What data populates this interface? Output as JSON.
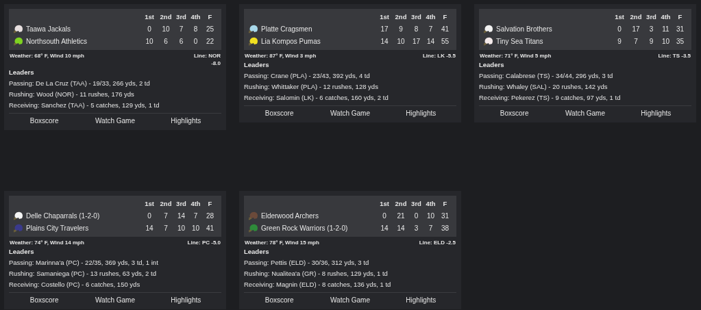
{
  "games": [
    {
      "periods": [
        "1st",
        "2nd",
        "3rd",
        "4th",
        "F"
      ],
      "teams": [
        {
          "name": "Taawa Jackals",
          "color": "#e8e0e0",
          "scores": [
            "0",
            "10",
            "7",
            "8",
            "25"
          ]
        },
        {
          "name": "Northsouth Athletics",
          "color": "#7ed321",
          "scores": [
            "10",
            "6",
            "6",
            "0",
            "22"
          ]
        }
      ],
      "weather": "Weather: 68° F, Wind 10 mph",
      "line": "Line: NOR -8.0",
      "leaders_title": "Leaders",
      "leaders": [
        "Passing: De La Cruz (TAA) - 19/33, 266 yds, 2 td",
        "Rushing: Wood (NOR) - 11 rushes, 176 yds",
        "Receiving: Sanchez (TAA) - 5 catches, 129 yds, 1 td"
      ],
      "links": [
        "Boxscore",
        "Watch Game",
        "Highlights"
      ]
    },
    {
      "periods": [
        "1st",
        "2nd",
        "3rd",
        "4th",
        "F"
      ],
      "teams": [
        {
          "name": "Platte Cragsmen",
          "color": "#a8d8ea",
          "scores": [
            "17",
            "9",
            "8",
            "7",
            "41"
          ]
        },
        {
          "name": "Lia Kompos Pumas",
          "color": "#f0e020",
          "scores": [
            "14",
            "10",
            "17",
            "14",
            "55"
          ]
        }
      ],
      "weather": "Weather: 87° F, Wind 3 mph",
      "line": "Line: LK -5.5",
      "leaders_title": "Leaders",
      "leaders": [
        "Passing: Crane (PLA) - 23/43, 392 yds, 4 td",
        "Rushing: Whittaker (PLA) - 12 rushes, 128 yds",
        "Receiving: Salomin (LK) - 6 catches, 160 yds, 2 td"
      ],
      "links": [
        "Boxscore",
        "Watch Game",
        "Highlights"
      ]
    },
    {
      "periods": [
        "1st",
        "2nd",
        "3rd",
        "4th",
        "F"
      ],
      "teams": [
        {
          "name": "Salvation Brothers",
          "color": "#f2f2f2",
          "scores": [
            "0",
            "17",
            "3",
            "11",
            "31"
          ]
        },
        {
          "name": "Tiny Sea Titans",
          "color": "#f4eaea",
          "scores": [
            "9",
            "7",
            "9",
            "10",
            "35"
          ]
        }
      ],
      "weather": "Weather: 71° F, Wind 5 mph",
      "line": "Line: TS -3.5",
      "leaders_title": "Leaders",
      "leaders": [
        "Passing: Calabrese (TS) - 34/44, 296 yds, 3 td",
        "Rushing: Whaley (SAL) - 20 rushes, 142 yds",
        "Receiving: Pekerez (TS) - 9 catches, 97 yds, 1 td"
      ],
      "links": [
        "Boxscore",
        "Watch Game",
        "Highlights"
      ]
    },
    {
      "periods": [
        "1st",
        "2nd",
        "3rd",
        "4th",
        "F"
      ],
      "teams": [
        {
          "name": "Delle Chaparrals (1-2-0)",
          "color": "#f4f4f4",
          "scores": [
            "0",
            "7",
            "14",
            "7",
            "28"
          ]
        },
        {
          "name": "Plains City Travelers",
          "color": "#3a3a8c",
          "scores": [
            "14",
            "7",
            "10",
            "10",
            "41"
          ]
        }
      ],
      "weather": "Weather: 74° F, Wind 14 mph",
      "line": "Line: PC -5.0",
      "leaders_title": "Leaders",
      "leaders": [
        "Passing: Marinna'a (PC) - 22/35, 369 yds, 3 td, 1 int",
        "Rushing: Samaniega (PC) - 13 rushes, 63 yds, 2 td",
        "Receiving: Costello (PC) - 6 catches, 150 yds"
      ],
      "links": [
        "Boxscore",
        "Watch Game",
        "Highlights"
      ]
    },
    {
      "periods": [
        "1st",
        "2nd",
        "3rd",
        "4th",
        "F"
      ],
      "teams": [
        {
          "name": "Elderwood Archers",
          "color": "#6b4a3a",
          "scores": [
            "0",
            "21",
            "0",
            "10",
            "31"
          ]
        },
        {
          "name": "Green Rock Warriors (1-2-0)",
          "color": "#2e8b3a",
          "scores": [
            "14",
            "14",
            "3",
            "7",
            "38"
          ]
        }
      ],
      "weather": "Weather: 78° F, Wind 15 mph",
      "line": "Line: ELD -2.5",
      "leaders_title": "Leaders",
      "leaders": [
        "Passing: Pettis (ELD) - 30/36, 312 yds, 3 td",
        "Rushing: Nualitea'a (GR) - 8 rushes, 129 yds, 1 td",
        "Receiving: Magnin (ELD) - 8 catches, 136 yds, 1 td"
      ],
      "links": [
        "Boxscore",
        "Watch Game",
        "Highlights"
      ]
    }
  ]
}
